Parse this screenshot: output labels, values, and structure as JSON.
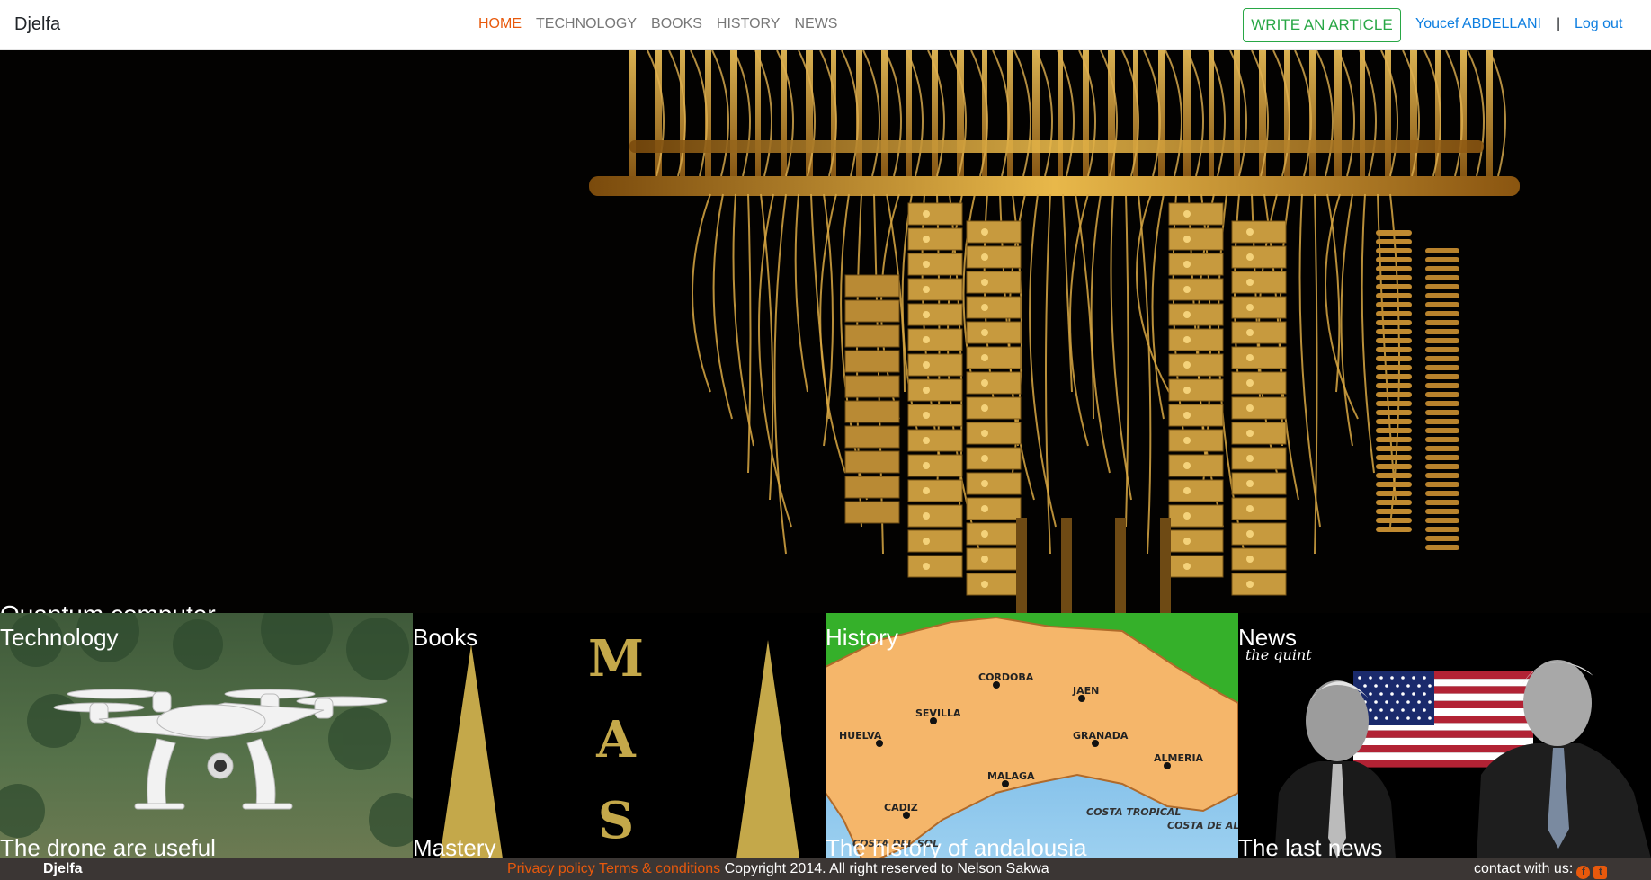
{
  "navbar": {
    "brand": "Djelfa",
    "links": [
      "HOME",
      "TECHNOLOGY",
      "BOOKS",
      "HISTORY",
      "NEWS"
    ],
    "active_link": "HOME",
    "write_button": "WRITE AN ARTICLE",
    "user_name": "Youcef ABDELLANI",
    "separator": "|",
    "logout": "Log out"
  },
  "hero": {
    "title": "Quantum computer"
  },
  "cards": [
    {
      "category": "Technology",
      "title": "The drone are useful"
    },
    {
      "category": "Books",
      "title": "Mastery",
      "cover_letters": "MAS"
    },
    {
      "category": "History",
      "title": "The history of andalousia",
      "map_labels": [
        "CORDOBA",
        "JAEN",
        "SEVILLA",
        "HUELVA",
        "GRANADA",
        "ALMERIA",
        "MALAGA",
        "CADIZ",
        "COSTA TROPICAL",
        "COSTA DEL SOL",
        "COSTA DE ALMERIA"
      ]
    },
    {
      "category": "News",
      "title": "The last news",
      "watermark": "the quint"
    }
  ],
  "footer": {
    "brand": "Djelfa",
    "privacy": "Privacy policy",
    "terms": "Terms & conditions",
    "copyright": "Copyright 2014. All right reserved to Nelson Sakwa",
    "contact": "contact with us:",
    "social_icons": [
      "facebook-icon",
      "twitter-icon"
    ]
  },
  "colors": {
    "accent": "#e8590c",
    "link": "#0d7ee0",
    "success": "#28a745",
    "footer_bg": "#3b3634"
  }
}
